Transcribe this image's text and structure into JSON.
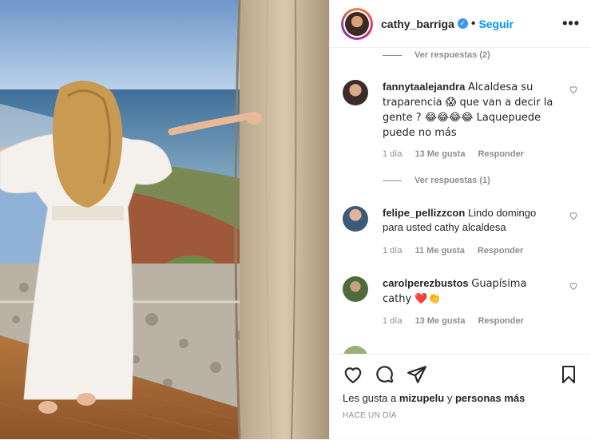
{
  "post": {
    "username": "cathy_barriga",
    "follow_label": "Seguir",
    "more_label": "•••",
    "verified_mark": "✓"
  },
  "comments": [
    {
      "pre_replies": "Ver respuestas (2)"
    },
    {
      "username": "fannytaalejandra",
      "text": "Alcaldesa su traparencia 😱 que van a decir la gente ? 😂😂😂😂 Laquepuede puede no más",
      "time": "1 día",
      "likes": "13 Me gusta",
      "reply": "Responder",
      "replies": "Ver respuestas (1)"
    },
    {
      "username": "felipe_pellizzcon",
      "text": "Lindo domingo para usted cathy alcaldesa",
      "time": "1 día",
      "likes": "11 Me gusta",
      "reply": "Responder"
    },
    {
      "username": "carolperezbustos",
      "text": "Guapísima cathy ❤️👏",
      "time": "1 día",
      "likes": "13 Me gusta",
      "reply": "Responder"
    }
  ],
  "footer": {
    "likes_prefix": "Les gusta a",
    "likes_user": "mizupelu",
    "likes_mid": "y",
    "likes_rest": "personas más",
    "time_ago": "HACE UN DÍA"
  }
}
